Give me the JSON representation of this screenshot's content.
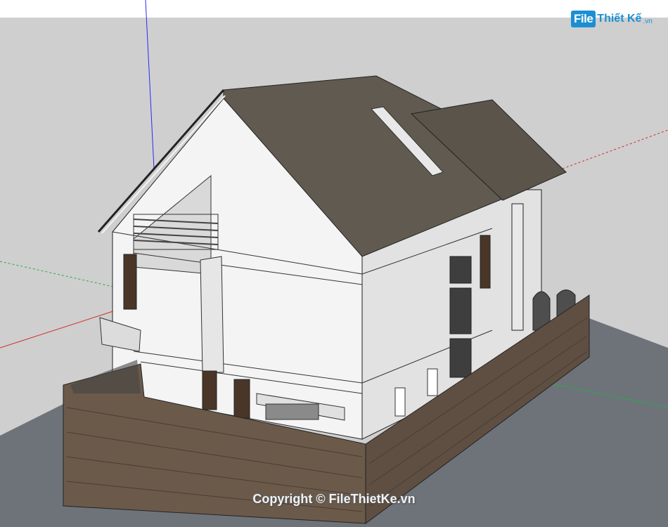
{
  "watermark": {
    "logo_box": "File",
    "logo_text": "Thiết Kế",
    "logo_suffix": ".vn",
    "copyright": "Copyright © FileThietKe.vn"
  },
  "colors": {
    "sky": "#ffffff",
    "ground": "#cfcfcf",
    "road": "#6e737a",
    "wall_white": "#f4f4f4",
    "wall_shade": "#d9d9d9",
    "roof": "#615a50",
    "stone": "#6b5a4a",
    "axis_blue": "#2a2aff",
    "axis_red": "#d22a2a",
    "axis_green": "#2aa84a",
    "logo_blue": "#1c8fd3"
  },
  "icons": {
    "logo": "filethietke-logo-icon"
  }
}
